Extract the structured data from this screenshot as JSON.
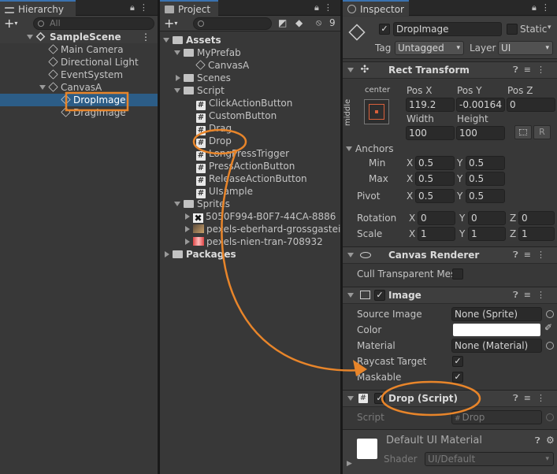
{
  "hierarchy": {
    "tab_label": "Hierarchy",
    "search_placeholder": "All",
    "scene_name": "SampleScene",
    "items": [
      "Main Camera",
      "Directional Light",
      "EventSystem",
      "CanvasA",
      "DropImage",
      "DragImage"
    ]
  },
  "project": {
    "tab_label": "Project",
    "hidden_count": "9",
    "tree": {
      "assets": "Assets",
      "myprefab": "MyPrefab",
      "canvasa": "CanvasA",
      "scenes": "Scenes",
      "script": "Script",
      "scripts": [
        "ClickActionButton",
        "CustomButton",
        "Drag",
        "Drop",
        "LongPressTrigger",
        "PressActionButton",
        "ReleaseActionButton",
        "UIsample"
      ],
      "sprites": "Sprites",
      "sprite_items": [
        "5050F994-B0F7-44CA-8886",
        "pexels-eberhard-grossgasteig",
        "pexels-nien-tran-708932"
      ],
      "packages": "Packages"
    }
  },
  "inspector": {
    "tab_label": "Inspector",
    "object_name": "DropImage",
    "static_label": "Static",
    "tag_label": "Tag",
    "tag_value": "Untagged",
    "layer_label": "Layer",
    "layer_value": "UI",
    "rect_transform": {
      "title": "Rect Transform",
      "anchor_h": "center",
      "anchor_v": "middle",
      "pos_x_label": "Pos X",
      "pos_y_label": "Pos Y",
      "pos_z_label": "Pos Z",
      "pos_x": "119.2",
      "pos_y": "-0.00164",
      "pos_z": "0",
      "width_label": "Width",
      "height_label": "Height",
      "width": "100",
      "height": "100",
      "r_button": "R",
      "anchors_label": "Anchors",
      "min_label": "Min",
      "max_label": "Max",
      "min_x": "0.5",
      "min_y": "0.5",
      "max_x": "0.5",
      "max_y": "0.5",
      "pivot_label": "Pivot",
      "pivot_x": "0.5",
      "pivot_y": "0.5",
      "rotation_label": "Rotation",
      "rot_x": "0",
      "rot_y": "0",
      "rot_z": "0",
      "scale_label": "Scale",
      "scale_x": "1",
      "scale_y": "1",
      "scale_z": "1",
      "x": "X",
      "y": "Y",
      "z": "Z"
    },
    "canvas_renderer": {
      "title": "Canvas Renderer",
      "cull_label": "Cull Transparent Mes"
    },
    "image": {
      "title": "Image",
      "source_label": "Source Image",
      "source_value": "None (Sprite)",
      "color_label": "Color",
      "material_label": "Material",
      "material_value": "None (Material)",
      "raycast_label": "Raycast Target",
      "maskable_label": "Maskable"
    },
    "drop_script": {
      "title": "Drop (Script)",
      "script_label": "Script",
      "script_value": "Drop"
    },
    "material": {
      "name": "Default UI Material",
      "shader_label": "Shader",
      "shader_value": "UI/Default"
    }
  },
  "colors": {
    "annotation": "#e8852a",
    "selection": "#2c5d87",
    "panel_bg": "#383838"
  },
  "icons": [
    "lock-icon",
    "kebab-menu-icon",
    "search-icon",
    "unity-scene-icon",
    "gameobject-cube-icon",
    "folder-icon",
    "prefab-icon",
    "script-hash-icon",
    "eye-slash-icon",
    "help-icon",
    "settings-sliders-icon",
    "image-icon",
    "eye-icon",
    "move-tool-icon"
  ]
}
